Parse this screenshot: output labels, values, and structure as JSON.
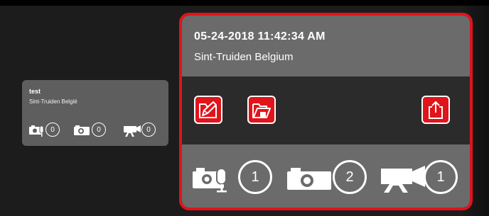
{
  "small_card": {
    "title": "test",
    "location": "Sint-Truiden België",
    "counters": [
      {
        "icon": "photo-voice-icon",
        "count": "0"
      },
      {
        "icon": "camera-icon",
        "count": "0"
      },
      {
        "icon": "video-camera-icon",
        "count": "0"
      }
    ]
  },
  "selected_card": {
    "datetime": "05-24-2018 11:42:34 AM",
    "location": "Sint-Truiden Belgium",
    "actions": [
      {
        "icon": "edit-folder-icon"
      },
      {
        "icon": "open-folder-icon"
      },
      {
        "icon": "share-icon"
      }
    ],
    "counters": [
      {
        "icon": "photo-voice-icon",
        "count": "1"
      },
      {
        "icon": "camera-icon",
        "count": "2"
      },
      {
        "icon": "video-camera-icon",
        "count": "1"
      }
    ]
  },
  "colors": {
    "accent": "#e0141a",
    "card_gray": "#6b6b6b",
    "background": "#1c1c1c"
  }
}
